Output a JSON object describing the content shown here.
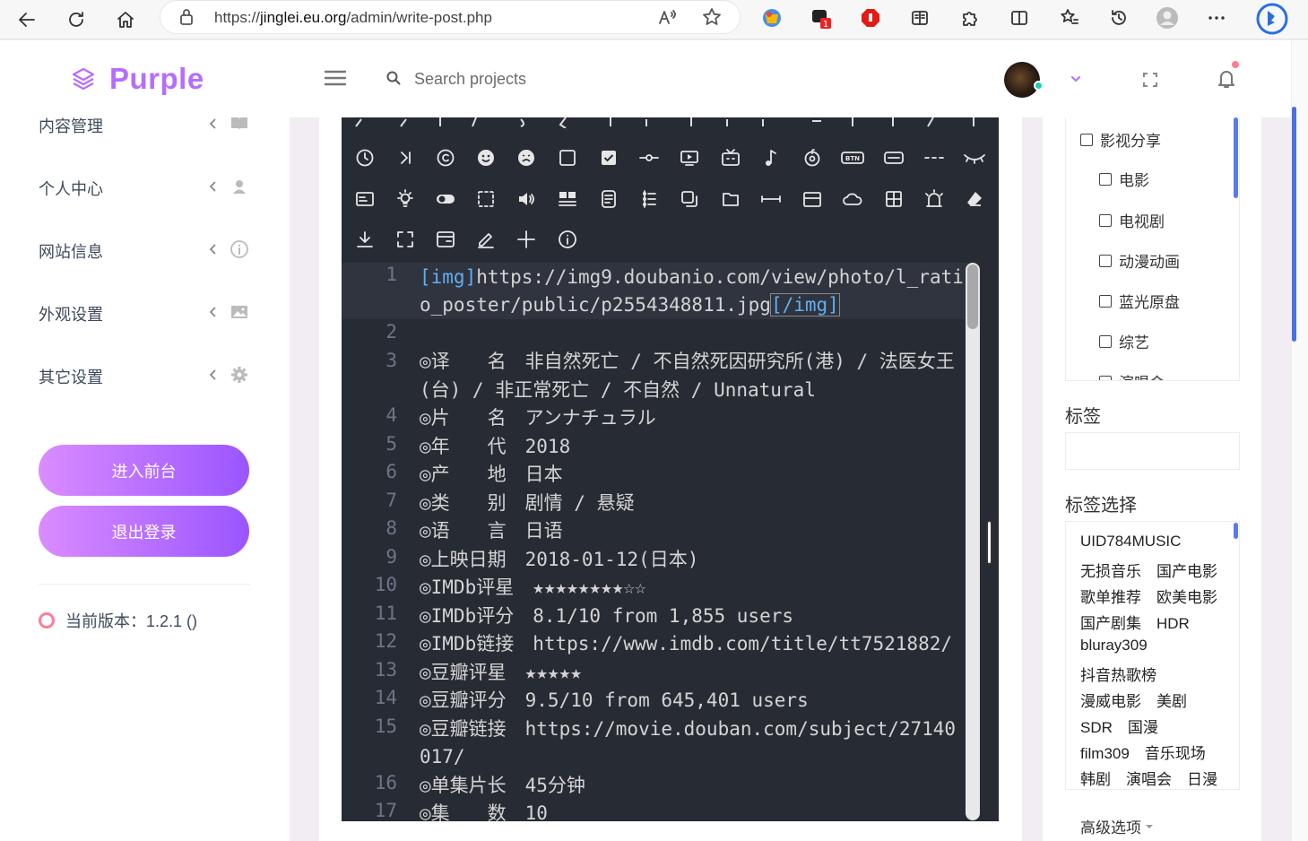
{
  "browser": {
    "url_prefix": "https://",
    "url_domain": "jinglei.eu.org",
    "url_path": "/admin/write-post.php",
    "ext_badge": "1"
  },
  "header": {
    "logo_text": "Purple",
    "search_placeholder": "Search projects"
  },
  "sidebar": {
    "items": [
      {
        "label": "内容管理",
        "icon": "book-icon"
      },
      {
        "label": "个人中心",
        "icon": "user-icon"
      },
      {
        "label": "网站信息",
        "icon": "info-icon"
      },
      {
        "label": "外观设置",
        "icon": "image-icon"
      },
      {
        "label": "其它设置",
        "icon": "gear-icon"
      }
    ],
    "enter_frontend": "进入前台",
    "logout": "退出登录",
    "version": "当前版本：1.2.1 ()"
  },
  "editor": {
    "lines": [
      {
        "n": "1",
        "pre": "",
        "tag1": "[img]",
        "mid": "https://img9.doubanio.com/view/photo/l_ratio_poster/public/p2554348811.jpg",
        "tag2": "[/img]",
        "active": true
      },
      {
        "n": "2",
        "text": " "
      },
      {
        "n": "3",
        "text": "◎译　　名　非自然死亡 / 不自然死因研究所(港) / 法医女王(台) / 非正常死亡 / 不自然 / Unnatural"
      },
      {
        "n": "4",
        "text": "◎片　　名　アンナチュラル"
      },
      {
        "n": "5",
        "text": "◎年　　代　2018"
      },
      {
        "n": "6",
        "text": "◎产　　地　日本"
      },
      {
        "n": "7",
        "text": "◎类　　别　剧情 / 悬疑"
      },
      {
        "n": "8",
        "text": "◎语　　言　日语"
      },
      {
        "n": "9",
        "text": "◎上映日期　2018-01-12(日本)"
      },
      {
        "n": "10",
        "text": "◎IMDb评星　★★★★★★★★☆☆"
      },
      {
        "n": "11",
        "text": "◎IMDb评分　8.1/10 from 1,855 users"
      },
      {
        "n": "12",
        "text": "◎IMDb链接　https://www.imdb.com/title/tt7521882/"
      },
      {
        "n": "13",
        "text": "◎豆瓣评星　★★★★★"
      },
      {
        "n": "14",
        "text": "◎豆瓣评分　9.5/10 from 645,401 users"
      },
      {
        "n": "15",
        "text": "◎豆瓣链接　https://movie.douban.com/subject/27140017/"
      },
      {
        "n": "16",
        "text": "◎单集片长　45分钟"
      },
      {
        "n": "17",
        "text": "◎集　　数　10"
      }
    ]
  },
  "categories": {
    "items": [
      {
        "label": "影视分享",
        "level": 0
      },
      {
        "label": "电影",
        "level": 1
      },
      {
        "label": "电视剧",
        "level": 1
      },
      {
        "label": "动漫动画",
        "level": 1
      },
      {
        "label": "蓝光原盘",
        "level": 1
      },
      {
        "label": "综艺",
        "level": 1
      },
      {
        "label": "演唱会",
        "level": 1
      }
    ]
  },
  "tags": {
    "title": "标签",
    "select_title": "标签选择",
    "lines": [
      "UID784MUSIC",
      "无损音乐　国产电影",
      "歌单推荐　欧美电影",
      "国产剧集　HDR",
      "bluray309",
      "抖音热歌榜",
      "漫威电影　美剧",
      "SDR　国漫",
      "film309　音乐现场",
      "韩剧　演唱会　日漫"
    ]
  },
  "advanced_label": "高级选项",
  "colors": {
    "brand": "#b66dff",
    "editor_bg": "#272b34",
    "online": "#1bcfb4",
    "notify": "#fe7c96"
  }
}
